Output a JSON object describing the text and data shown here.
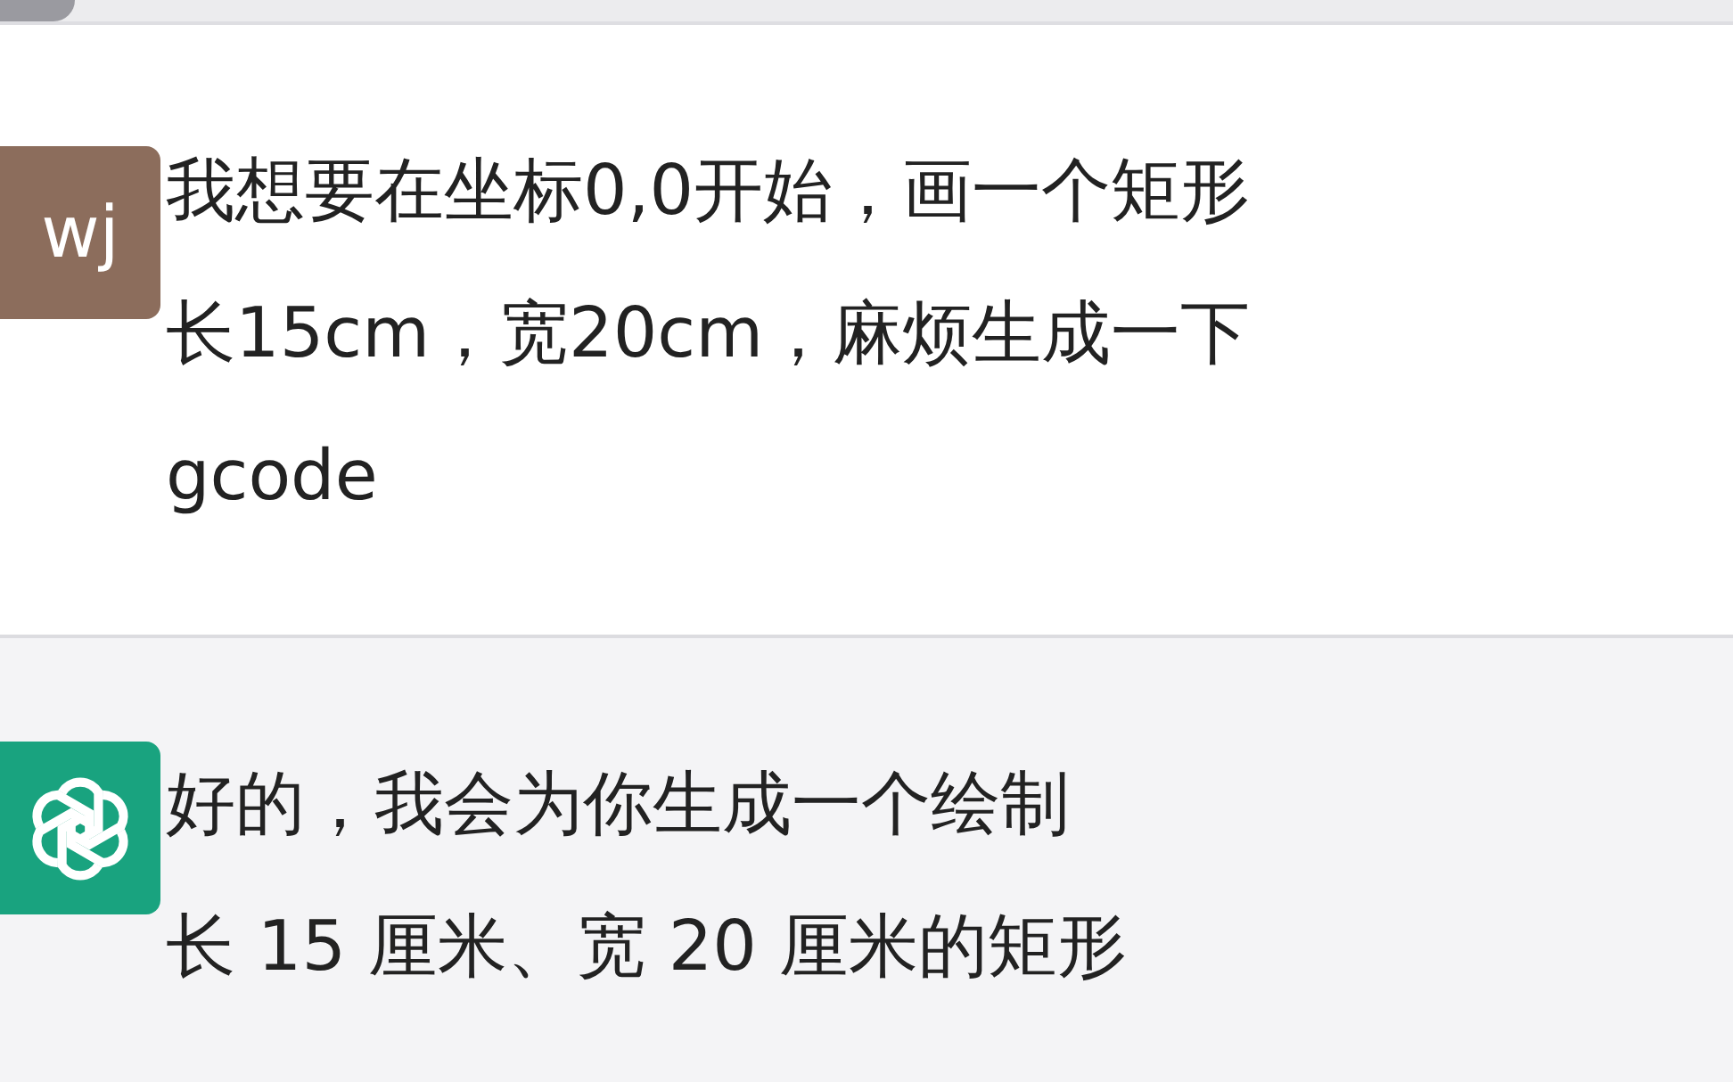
{
  "messages": [
    {
      "kind": "user",
      "avatar": "wj",
      "lines": [
        "我想要在坐标0,0开始，画一个矩形",
        "长15cm，宽20cm，麻烦生成一下",
        "gcode"
      ]
    },
    {
      "kind": "assistant",
      "lines": [
        "好的，我会为你生成一个绘制",
        "长 15 厘米、宽 20 厘米的矩形"
      ]
    }
  ]
}
